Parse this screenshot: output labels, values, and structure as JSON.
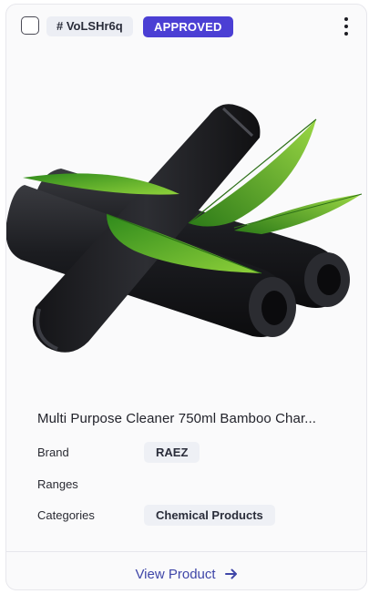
{
  "card": {
    "sku": "# VoLSHr6q",
    "status": "APPROVED",
    "title": "Multi Purpose Cleaner 750ml Bamboo Char...",
    "attributes": {
      "brand": {
        "label": "Brand",
        "value": "RAEZ"
      },
      "ranges": {
        "label": "Ranges",
        "value": ""
      },
      "categories": {
        "label": "Categories",
        "value": "Chemical Products"
      }
    },
    "view_link": "View Product",
    "image_alt": "charcoal-sticks-with-leaves"
  },
  "colors": {
    "status_badge": "#4b3fd4",
    "link": "#3f46a8",
    "chip": "#eef0f5"
  },
  "icons": {
    "menu": "kebab-vertical-icon",
    "arrow": "arrow-right-icon",
    "select": "checkbox-icon"
  }
}
